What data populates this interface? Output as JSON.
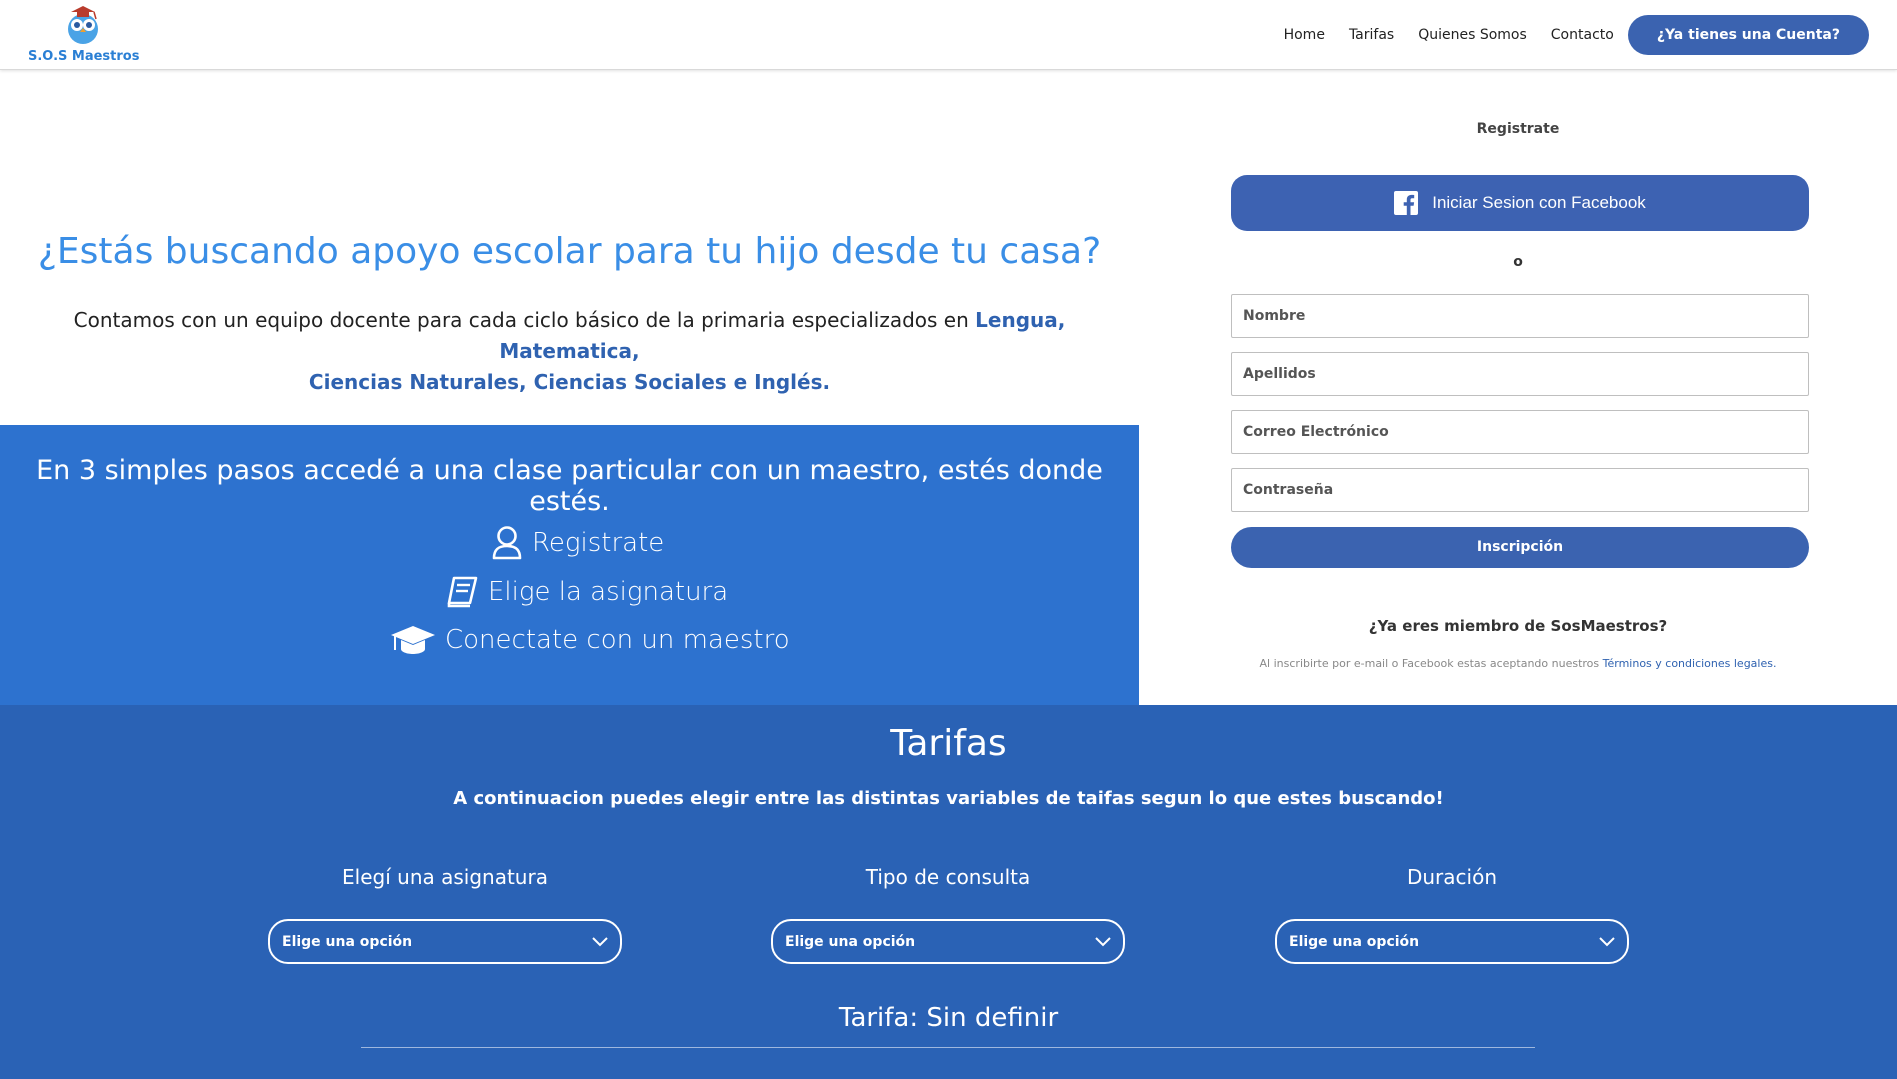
{
  "header": {
    "logo_text": "S.O.S Maestros",
    "nav": [
      "Home",
      "Tarifas",
      "Quienes Somos",
      "Contacto"
    ],
    "account_button": "¿Ya tienes una Cuenta?"
  },
  "hero": {
    "title": "¿Estás buscando apoyo escolar para tu hijo desde tu casa?",
    "text_prefix": "Contamos con un equipo docente para cada ciclo básico de la primaria especializados en",
    "subjects_line1": "Lengua, Matematica,",
    "subjects_line2": "Ciencias Naturales, Ciencias Sociales e Inglés."
  },
  "steps": {
    "title": "En 3 simples pasos accedé a una clase particular con un maestro, estés donde estés.",
    "items": [
      "Registrate",
      "Elige la asignatura",
      "Conectate con un maestro"
    ]
  },
  "form": {
    "title": "Registrate",
    "facebook_button": "Iniciar Sesion con Facebook",
    "or_text": "o",
    "fields": {
      "nombre": "Nombre",
      "apellidos": "Apellidos",
      "email": "Correo Electrónico",
      "password": "Contraseña"
    },
    "submit": "Inscripción",
    "member_text": "¿Ya eres miembro de SosMaestros?",
    "legal_prefix": "Al inscribirte por e-mail o Facebook estas aceptando nuestros",
    "legal_link": "Términos y condiciones legales."
  },
  "tarifas": {
    "title": "Tarifas",
    "subtitle": "A continuacion puedes elegir entre las distintas variables de taifas segun lo que estes buscando!",
    "columns": [
      {
        "label": "Elegí una asignatura",
        "placeholder": "Elige una opción"
      },
      {
        "label": "Tipo de consulta",
        "placeholder": "Elige una opción"
      },
      {
        "label": "Duración",
        "placeholder": "Elige una opción"
      }
    ],
    "result": "Tarifa: Sin definir"
  },
  "colors": {
    "brand": "#3b63b0",
    "hero_title": "#3a8ee6",
    "steps_bg": "#2d72cf",
    "tarifas_bg": "#2a62b5"
  }
}
